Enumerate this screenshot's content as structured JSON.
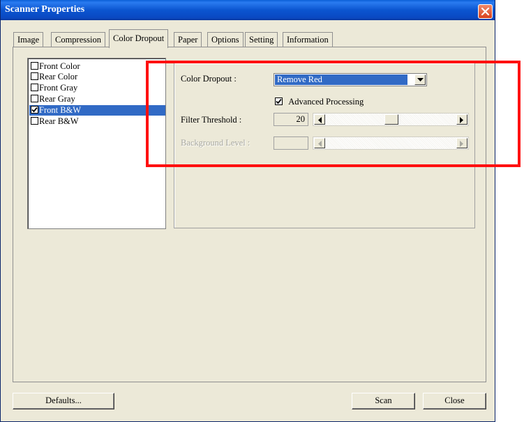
{
  "window": {
    "title": "Scanner Properties"
  },
  "tabs": [
    {
      "label": "Image",
      "active": false
    },
    {
      "label": "Compression",
      "active": false
    },
    {
      "label": "Color Dropout",
      "active": true
    },
    {
      "label": "Paper",
      "active": false
    },
    {
      "label": "Options",
      "active": false
    },
    {
      "label": "Setting",
      "active": false
    },
    {
      "label": "Information",
      "active": false
    }
  ],
  "image_list": [
    {
      "label": "Front Color",
      "checked": false,
      "selected": false
    },
    {
      "label": "Rear Color",
      "checked": false,
      "selected": false
    },
    {
      "label": "Front Gray",
      "checked": false,
      "selected": false
    },
    {
      "label": "Rear Gray",
      "checked": false,
      "selected": false
    },
    {
      "label": "Front B&W",
      "checked": true,
      "selected": true
    },
    {
      "label": "Rear B&W",
      "checked": false,
      "selected": false
    }
  ],
  "settings": {
    "color_dropout_label": "Color Dropout :",
    "color_dropout_value": "Remove Red",
    "advanced_processing_label": "Advanced Processing",
    "advanced_processing_checked": true,
    "filter_threshold_label": "Filter Threshold :",
    "filter_threshold_value": "20",
    "filter_threshold_slider_fraction": 0.5,
    "background_level_label": "Background Level :",
    "background_level_value": ""
  },
  "buttons": {
    "defaults": "Defaults...",
    "scan": "Scan",
    "close": "Close"
  },
  "colors": {
    "title_bar": "#0b55d0",
    "dialog_face": "#ece9d8",
    "selection": "#316ac5",
    "highlight_box": "#ff1010"
  }
}
